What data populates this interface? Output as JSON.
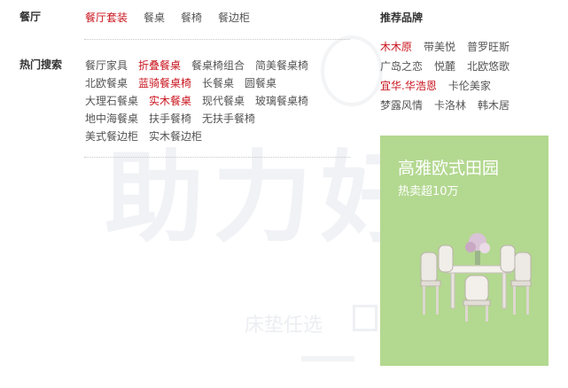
{
  "category": {
    "label": "餐厅",
    "links": [
      {
        "text": "餐厅套装",
        "hot": true
      },
      {
        "text": "餐桌",
        "hot": false
      },
      {
        "text": "餐椅",
        "hot": false
      },
      {
        "text": "餐边柜",
        "hot": false
      }
    ]
  },
  "hot_search": {
    "label": "热门搜索",
    "lines": [
      [
        {
          "text": "餐厅家具",
          "hot": false
        },
        {
          "text": "折叠餐桌",
          "hot": true
        },
        {
          "text": "餐桌椅组合",
          "hot": false
        },
        {
          "text": "简美餐桌椅",
          "hot": false
        }
      ],
      [
        {
          "text": "北欧餐桌",
          "hot": false
        },
        {
          "text": "蓝骑餐桌椅",
          "hot": true
        },
        {
          "text": "长餐桌",
          "hot": false
        },
        {
          "text": "圆餐桌",
          "hot": false
        }
      ],
      [
        {
          "text": "大理石餐桌",
          "hot": false
        },
        {
          "text": "实木餐桌",
          "hot": true
        },
        {
          "text": "现代餐桌",
          "hot": false
        },
        {
          "text": "玻璃餐桌椅",
          "hot": false
        }
      ],
      [
        {
          "text": "地中海餐桌",
          "hot": false
        },
        {
          "text": "扶手餐椅",
          "hot": false
        },
        {
          "text": "无扶手餐椅",
          "hot": false
        }
      ],
      [
        {
          "text": "美式餐边柜",
          "hot": false
        },
        {
          "text": "实木餐边柜",
          "hot": false
        }
      ]
    ]
  },
  "brands": {
    "title": "推荐品牌",
    "lines": [
      [
        {
          "text": "木木原",
          "hot": true
        },
        {
          "text": "带美悦",
          "hot": false
        },
        {
          "text": "普罗旺斯",
          "hot": false
        }
      ],
      [
        {
          "text": "广岛之恋",
          "hot": false
        },
        {
          "text": "悦麓",
          "hot": false
        },
        {
          "text": "北欧悠歌",
          "hot": false
        }
      ],
      [
        {
          "text": "宜华.华浩恩",
          "hot": true
        },
        {
          "text": "卡伦美家",
          "hot": false
        }
      ],
      [
        {
          "text": "梦露风情",
          "hot": false
        },
        {
          "text": "卡洛林",
          "hot": false
        },
        {
          "text": "韩木居",
          "hot": false
        }
      ]
    ]
  },
  "promo": {
    "title": "高雅欧式田园",
    "subtitle": "热卖超10万",
    "bg_color": "#b3d890"
  },
  "watermark": {
    "big": "助力好",
    "small": "床垫任选"
  },
  "colors": {
    "hot": "#c9151e",
    "text": "#555555",
    "label": "#333333"
  }
}
